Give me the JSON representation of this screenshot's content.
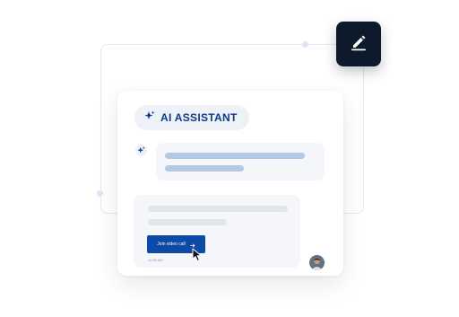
{
  "assistant": {
    "title": "AI ASSISTANT",
    "icon": "sparkle-icon"
  },
  "message": {
    "button_label": "Join video call",
    "button_icon": "arrow-right-icon",
    "timestamp": "11:55 AM"
  },
  "badge": {
    "icon": "pencil-icon"
  },
  "colors": {
    "brand": "#0d3b8a",
    "button": "#0d4aa6",
    "badge_bg": "#0c1a2b",
    "bubble_bg": "#f4f6fa",
    "ai_text_bar": "#b3c8e3",
    "user_text_bar": "#e1e5ec"
  }
}
